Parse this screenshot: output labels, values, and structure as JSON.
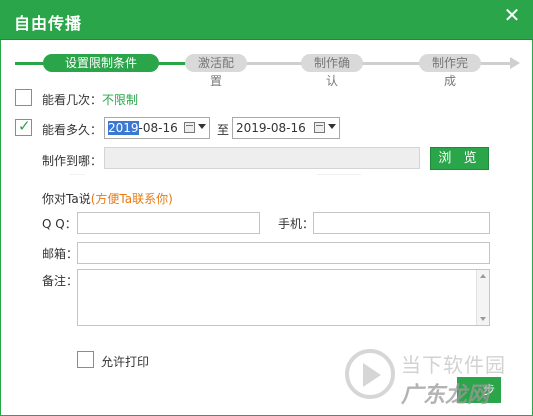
{
  "window": {
    "title": "自由传播",
    "close_icon": "close-icon"
  },
  "steps": [
    {
      "label": "设置限制条件",
      "active": true
    },
    {
      "label": "激活配置",
      "active": false
    },
    {
      "label": "制作确认",
      "active": false
    },
    {
      "label": "制作完成",
      "active": false
    }
  ],
  "view_count": {
    "label": "能看几次：",
    "value": "不限制",
    "checked": false
  },
  "view_duration": {
    "label": "能看多久：",
    "start_date_selected": "2019",
    "start_date_rest": "-08-16",
    "to_label": "至",
    "end_date": "2019-08-16",
    "checked": true
  },
  "make_to": {
    "label": "制作到哪：",
    "value": "",
    "browse_label": "浏 览"
  },
  "message": {
    "label": "你对Ta说",
    "hint": "(方便Ta联系你)"
  },
  "qq": {
    "label": "Q  Q：",
    "value": ""
  },
  "phone": {
    "label": "手机：",
    "value": ""
  },
  "email": {
    "label": "邮箱：",
    "value": ""
  },
  "note": {
    "label": "备注：",
    "value": ""
  },
  "allow_print": {
    "label": "允许打印",
    "checked": false
  },
  "watermark": {
    "line1": "当下软件园",
    "line2": "广东龙网"
  },
  "next_button": {
    "label": "步"
  },
  "colors": {
    "accent": "#2aa54a",
    "hint": "#e87a12",
    "selection": "#3a78d4"
  }
}
